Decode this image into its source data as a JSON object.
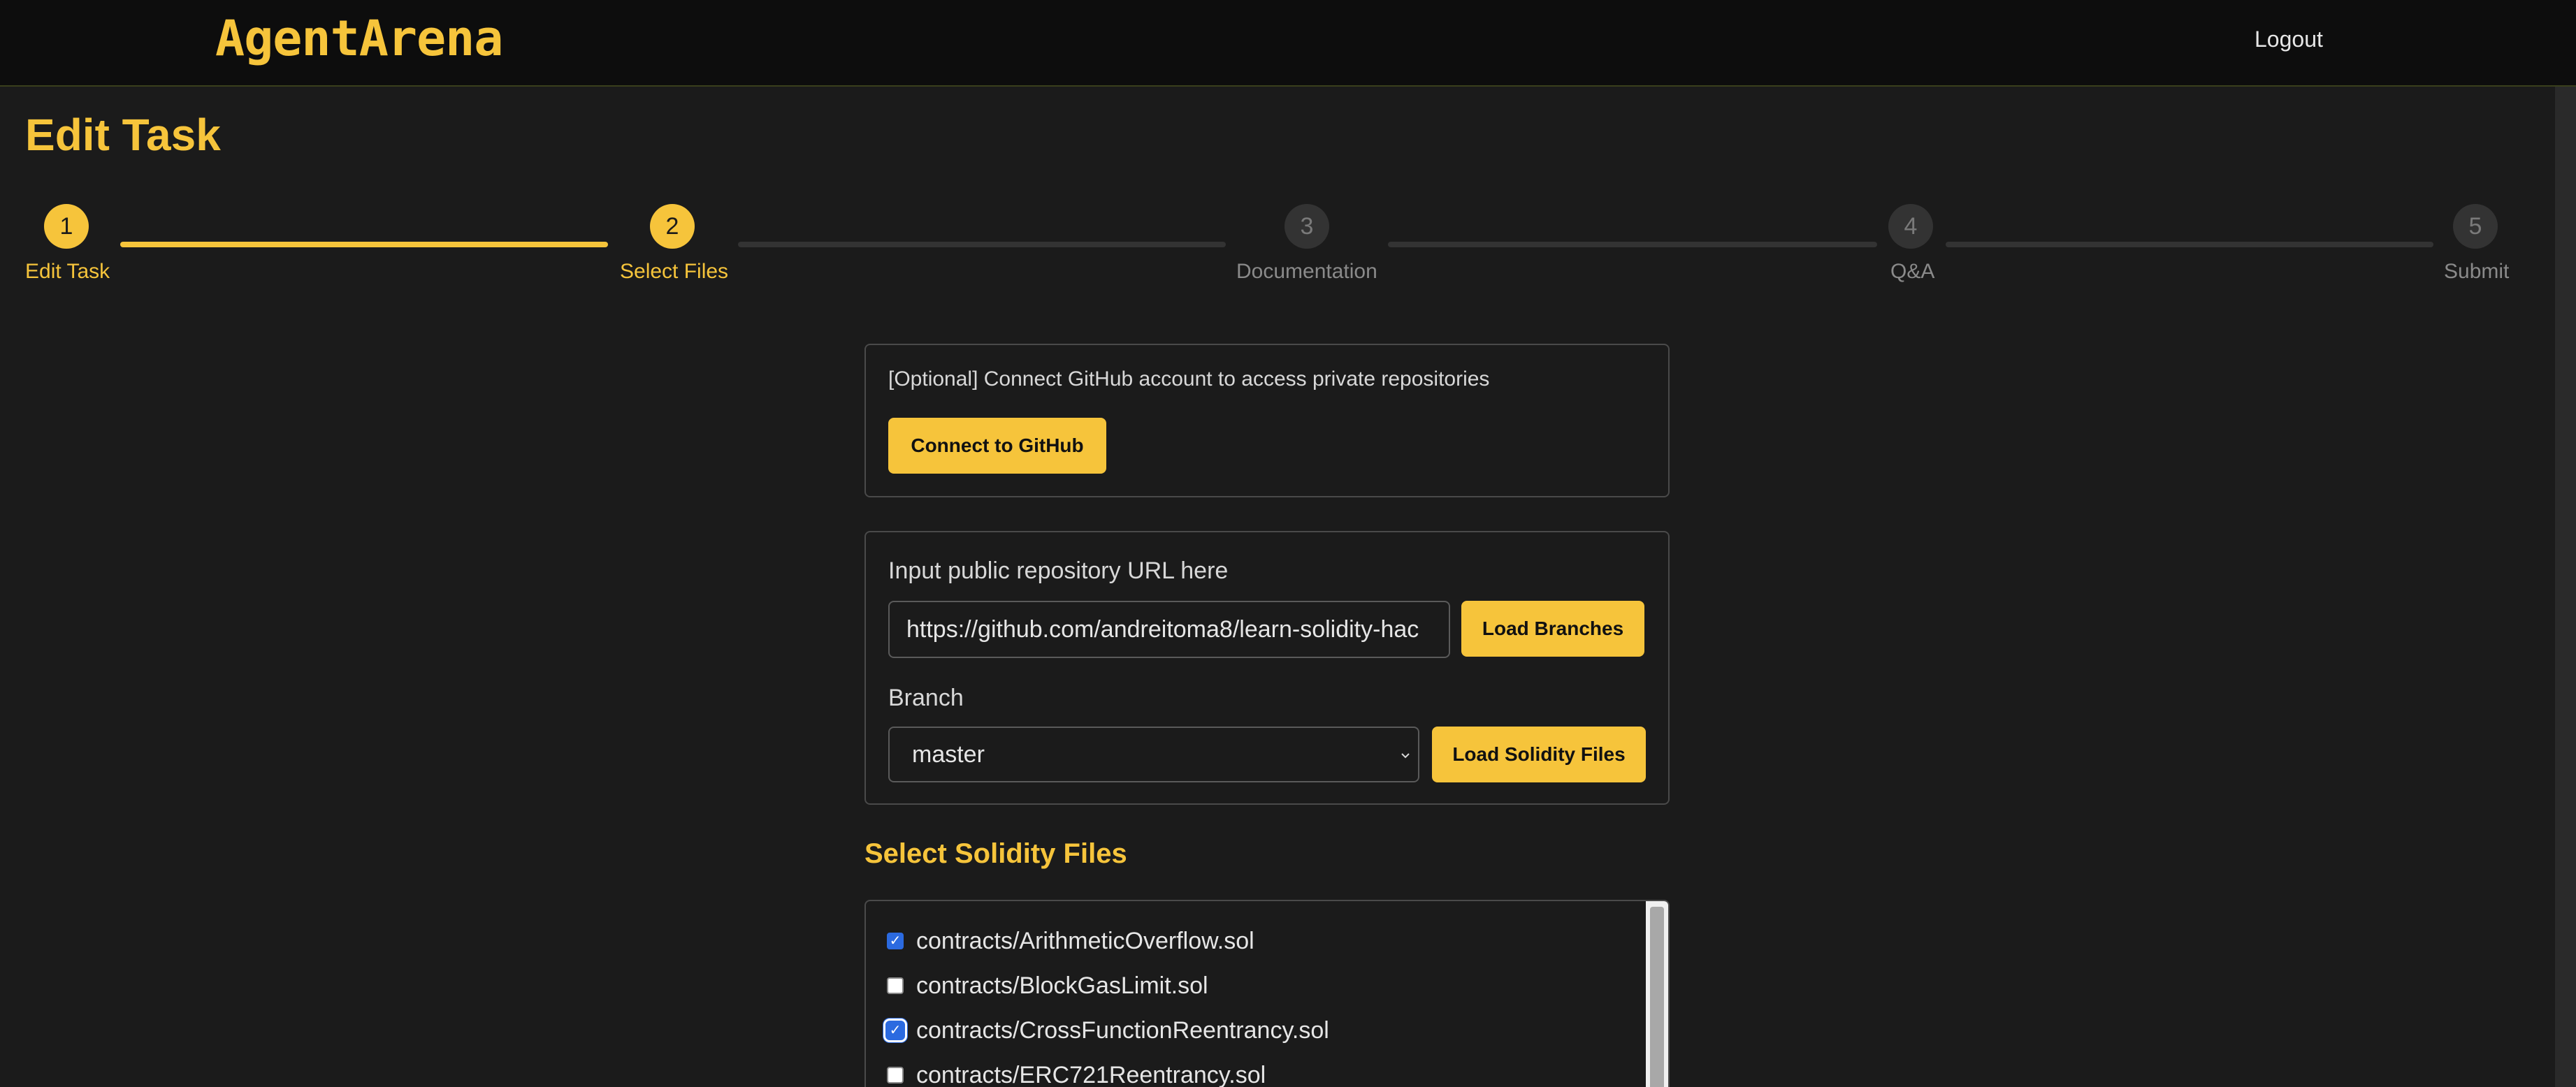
{
  "header": {
    "logo": "AgentArena",
    "logout_label": "Logout"
  },
  "page": {
    "title": "Edit Task"
  },
  "stepper": {
    "steps": [
      {
        "number": "1",
        "label": "Edit Task",
        "state": "active"
      },
      {
        "number": "2",
        "label": "Select Files",
        "state": "active"
      },
      {
        "number": "3",
        "label": "Documentation",
        "state": "inactive"
      },
      {
        "number": "4",
        "label": "Q&A",
        "state": "inactive"
      },
      {
        "number": "5",
        "label": "Submit",
        "state": "inactive"
      }
    ]
  },
  "github_panel": {
    "description": "[Optional] Connect GitHub account to access private repositories",
    "connect_label": "Connect to GitHub"
  },
  "repo_panel": {
    "url_label": "Input public repository URL here",
    "url_value": "https://github.com/andreitoma8/learn-solidity-hac",
    "load_branches_label": "Load Branches",
    "branch_label": "Branch",
    "branch_value": "master",
    "load_files_label": "Load Solidity Files"
  },
  "files_section": {
    "title": "Select Solidity Files",
    "files": [
      {
        "name": "contracts/ArithmeticOverflow.sol",
        "checked": true
      },
      {
        "name": "contracts/BlockGasLimit.sol",
        "checked": false
      },
      {
        "name": "contracts/CrossFunctionReentrancy.sol",
        "checked": true
      },
      {
        "name": "contracts/ERC721Reentrancy.sol",
        "checked": false
      }
    ]
  },
  "colors": {
    "accent": "#f6c43b",
    "background": "#1b1b1b",
    "topbar": "#0d0d0d",
    "checkbox": "#2b6ae0"
  }
}
